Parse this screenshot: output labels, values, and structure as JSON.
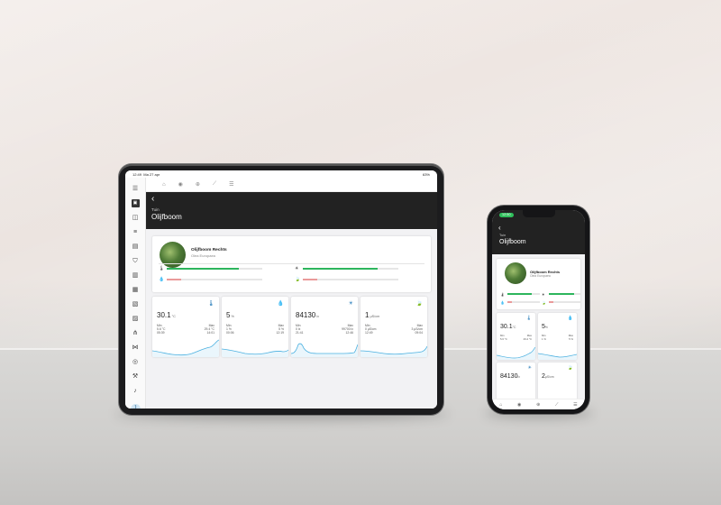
{
  "tablet": {
    "status": {
      "time": "12:49",
      "date": "Ma 27 apr",
      "battery": "63%"
    },
    "sidebar_icons": [
      "menu-icon",
      "plant-icon",
      "contact-icon",
      "list-icon",
      "chart-icon",
      "shield-icon",
      "document-icon",
      "task-icon",
      "book-icon",
      "report-icon",
      "hierarchy-icon",
      "vscode-icon",
      "compass-icon",
      "hammer-icon",
      "bell-icon"
    ],
    "avatar_initial": "J",
    "topnav_icons": [
      "home-icon",
      "eye-icon",
      "plus-icon",
      "trend-icon",
      "list-icon"
    ],
    "header": {
      "back": "‹",
      "breadcrumb": "Tuin",
      "title": "Olijfboom"
    },
    "plant": {
      "name": "Olijfboom Rechts",
      "latin": "Olea Europaea",
      "meters": [
        {
          "icon": "thermometer-icon",
          "glyph": "🌡",
          "level": 0.75,
          "color": "#2db55d"
        },
        {
          "icon": "sun-icon",
          "glyph": "☀",
          "level": 0.78,
          "color": "#2db55d"
        },
        {
          "icon": "drop-icon",
          "glyph": "💧",
          "level": 0.15,
          "color": "#ea9a9a"
        },
        {
          "icon": "leaf-icon",
          "glyph": "🍃",
          "level": 0.15,
          "color": "#ea9a9a"
        }
      ]
    },
    "tiles": [
      {
        "icon": "thermometer-icon",
        "glyph": "🌡",
        "value": "30.1",
        "unit": "°C",
        "min_label": "Min",
        "max_label": "Max",
        "min": "5.6 °C",
        "max": "29.4 °C",
        "min_time": "05:39",
        "max_time": "14:01"
      },
      {
        "icon": "drop-icon",
        "glyph": "💧",
        "value": "5",
        "unit": "%",
        "min_label": "Min",
        "max_label": "Max",
        "min": "1 %",
        "max": "5 %",
        "min_time": "00:06",
        "max_time": "12:19"
      },
      {
        "icon": "sun-icon",
        "glyph": "☀",
        "value": "84130",
        "unit": "lx",
        "min_label": "Min",
        "max_label": "Max",
        "min": "0 lx",
        "max": "99700 lx",
        "min_time": "21:41",
        "max_time": "12:46"
      },
      {
        "icon": "leaf-icon",
        "glyph": "🍃",
        "value": "1",
        "unit": "µS/cm",
        "min_label": "Min",
        "max_label": "Max",
        "min": "0 µS/cm",
        "max": "3 µS/cm",
        "min_time": "12:49",
        "max_time": "09:04"
      }
    ]
  },
  "phone": {
    "status_time": "12:50",
    "header": {
      "back": "‹",
      "breadcrumb": "Tuin",
      "title": "Olijfboom"
    },
    "plant": {
      "name": "Olijfboom Rechts",
      "latin": "Olea Europaea"
    },
    "tiles": [
      {
        "value": "30.1",
        "unit": "°C",
        "min": "5.6 °C",
        "max": "29.4 °C"
      },
      {
        "value": "5",
        "unit": "%",
        "min": "1 %",
        "max": "5 %"
      },
      {
        "value": "84130",
        "unit": "lx",
        "min": "0 lx",
        "max": "99700 lx"
      },
      {
        "value": "2",
        "unit": "µS/cm",
        "min": "0 µS/cm",
        "max": "3 µS/cm"
      }
    ],
    "tabbar_icons": [
      "home-icon",
      "eye-icon",
      "plus-icon",
      "trend-icon",
      "list-icon"
    ]
  },
  "colors": {
    "header": "#222222",
    "accent": "#1d76b6",
    "good": "#2db55d",
    "low": "#ea9a9a",
    "chart_line": "#4ab0e0"
  }
}
